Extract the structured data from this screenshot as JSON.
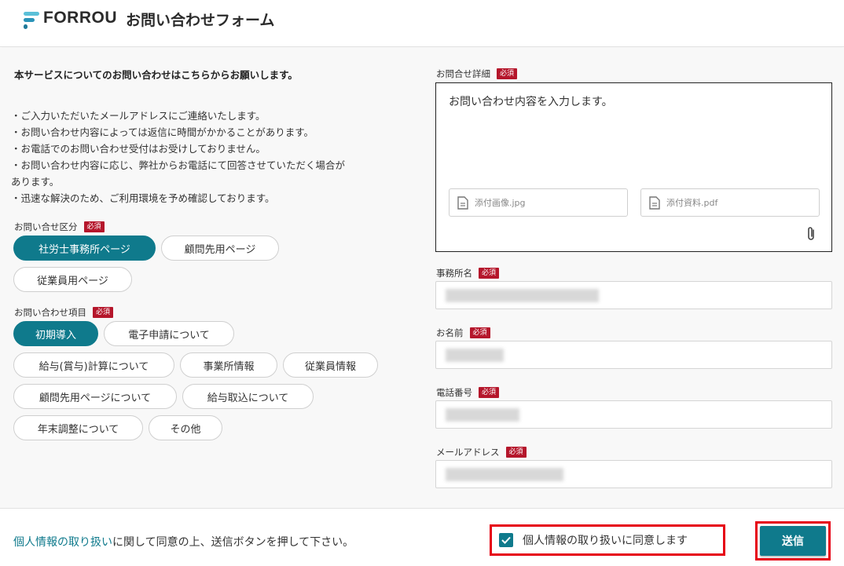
{
  "header": {
    "logo_text": "FORROU",
    "title": "お問い合わせフォーム"
  },
  "left": {
    "intro": "本サービスについてのお問い合わせはこちらからお願いします。",
    "notes": [
      "・ご入力いただいたメールアドレスにご連絡いたします。",
      "・お問い合わせ内容によっては返信に時間がかかることがあります。",
      "・お電話でのお問い合わせ受付はお受けしておりません。",
      "・お問い合わせ内容に応じ、弊社からお電話にて回答させていただく場合が",
      "あります。",
      "・迅速な解決のため、ご利用環境を予め確認しております。"
    ],
    "category": {
      "label": "お問い合せ区分",
      "required": "必須",
      "options": [
        "社労士事務所ページ",
        "顧問先用ページ",
        "従業員用ページ"
      ],
      "selected": "社労士事務所ページ"
    },
    "topic": {
      "label": "お問い合わせ項目",
      "required": "必須",
      "options": [
        "初期導入",
        "電子申請について",
        "給与(賞与)計算について",
        "事業所情報",
        "従業員情報",
        "顧問先用ページについて",
        "給与取込について",
        "年末調整について",
        "その他"
      ],
      "selected": "初期導入"
    }
  },
  "right": {
    "detail": {
      "label": "お問合せ詳細",
      "required": "必須",
      "value": "お問い合わせ内容を入力します。",
      "attachments": [
        "添付画像.jpg",
        "添付資料.pdf"
      ]
    },
    "office": {
      "label": "事務所名",
      "required": "必須"
    },
    "name": {
      "label": "お名前",
      "required": "必須"
    },
    "phone": {
      "label": "電話番号",
      "required": "必須"
    },
    "email": {
      "label": "メールアドレス",
      "required": "必須"
    }
  },
  "footer": {
    "privacy_link": "個人情報の取り扱い",
    "notice_rest": "に関して同意の上、送信ボタンを押して下さい。",
    "agree_label": "個人情報の取り扱いに同意します",
    "agree_checked": true,
    "submit_label": "送信"
  },
  "colors": {
    "accent": "#0f7a8c",
    "required": "#b5162b",
    "highlight": "#e60012"
  }
}
